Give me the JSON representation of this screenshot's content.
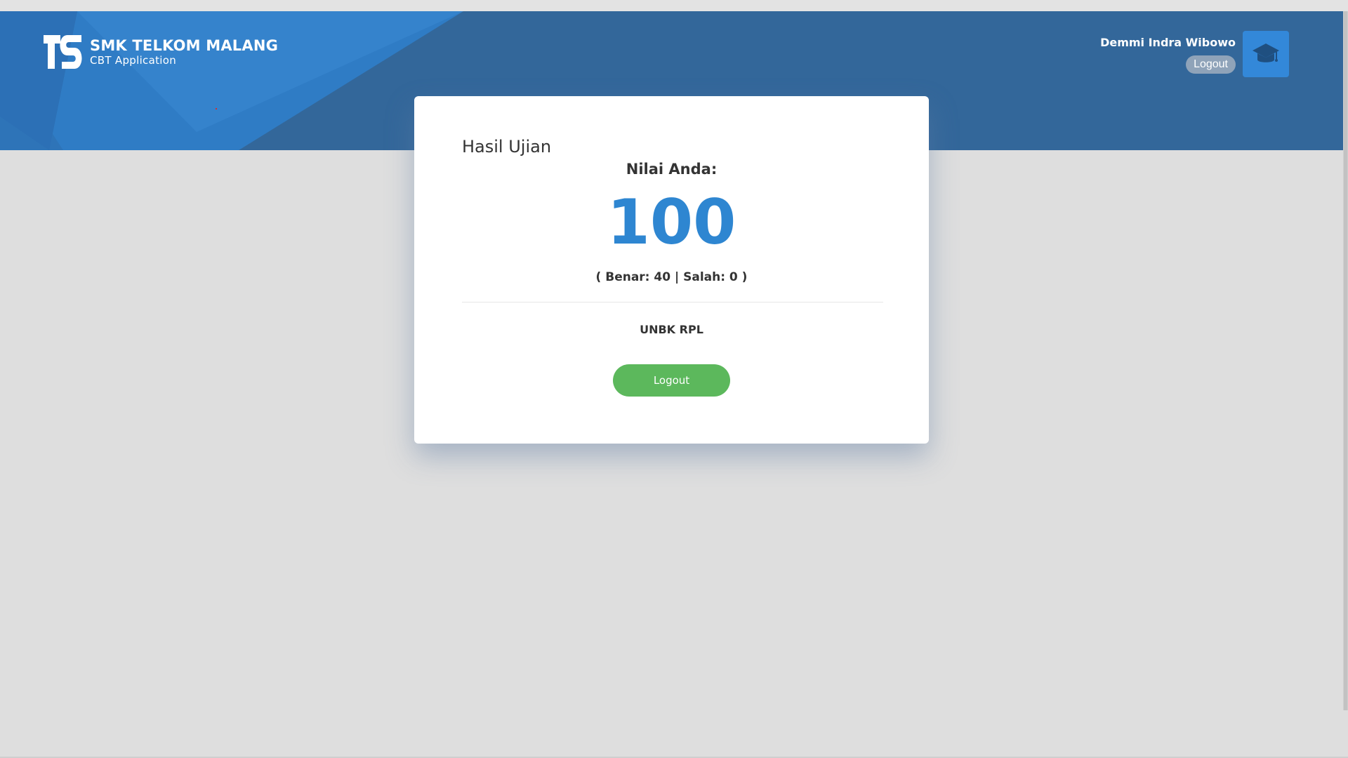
{
  "header": {
    "brand_title": "SMK TELKOM MALANG",
    "brand_subtitle": "CBT Application",
    "user_name": "Demmi Indra Wibowo",
    "logout_label": "Logout",
    "avatar_icon": "graduation-cap-icon",
    "colors": {
      "header_bg": "#33679a",
      "accent": "#2e86d1"
    }
  },
  "result": {
    "title": "Hasil Ujian",
    "score_label": "Nilai Anda:",
    "score_value": "100",
    "detail": "( Benar: 40 | Salah: 0 )",
    "exam_name": "UNBK RPL",
    "logout_label": "Logout",
    "button_color": "#5cb85c"
  }
}
